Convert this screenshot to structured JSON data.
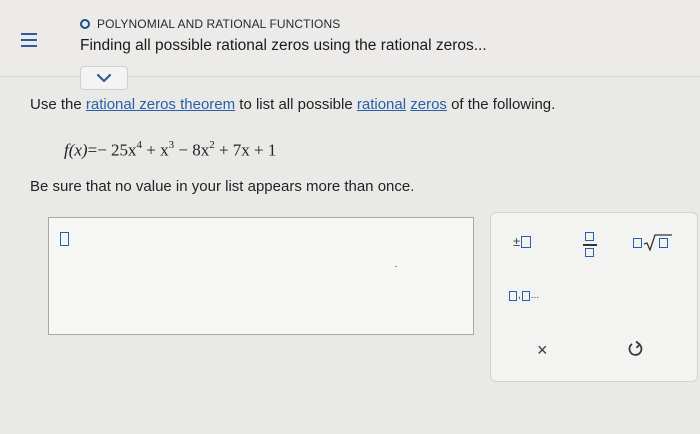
{
  "header": {
    "topic": "POLYNOMIAL AND RATIONAL FUNCTIONS",
    "title": "Finding all possible rational zeros using the rational zeros...",
    "menu_icon": "hamburger-menu-icon",
    "status_icon": "circle-status-icon",
    "expand_icon": "chevron-down-icon",
    "accent_color": "#2f5e96"
  },
  "question": {
    "prefix": "Use the ",
    "link1": "rational zeros theorem",
    "mid1": " to list all possible ",
    "link2": "rational",
    "mid2": " ",
    "link3": "zeros",
    "suffix": " of the following."
  },
  "formula": {
    "lhs": "f(x)",
    "eq": "=",
    "t1": "− 25x",
    "e1": "4",
    "t2": " + x",
    "e2": "3",
    "t3": " − 8x",
    "e3": "2",
    "t4": " + 7x + 1"
  },
  "note": "Be sure that no value in your list appears more than once.",
  "answer": {
    "value": ""
  },
  "keypad": {
    "plus_minus": "±",
    "list_sep": ",",
    "list_dots": "...",
    "clear_label": "×",
    "undo_icon": "undo-icon"
  }
}
